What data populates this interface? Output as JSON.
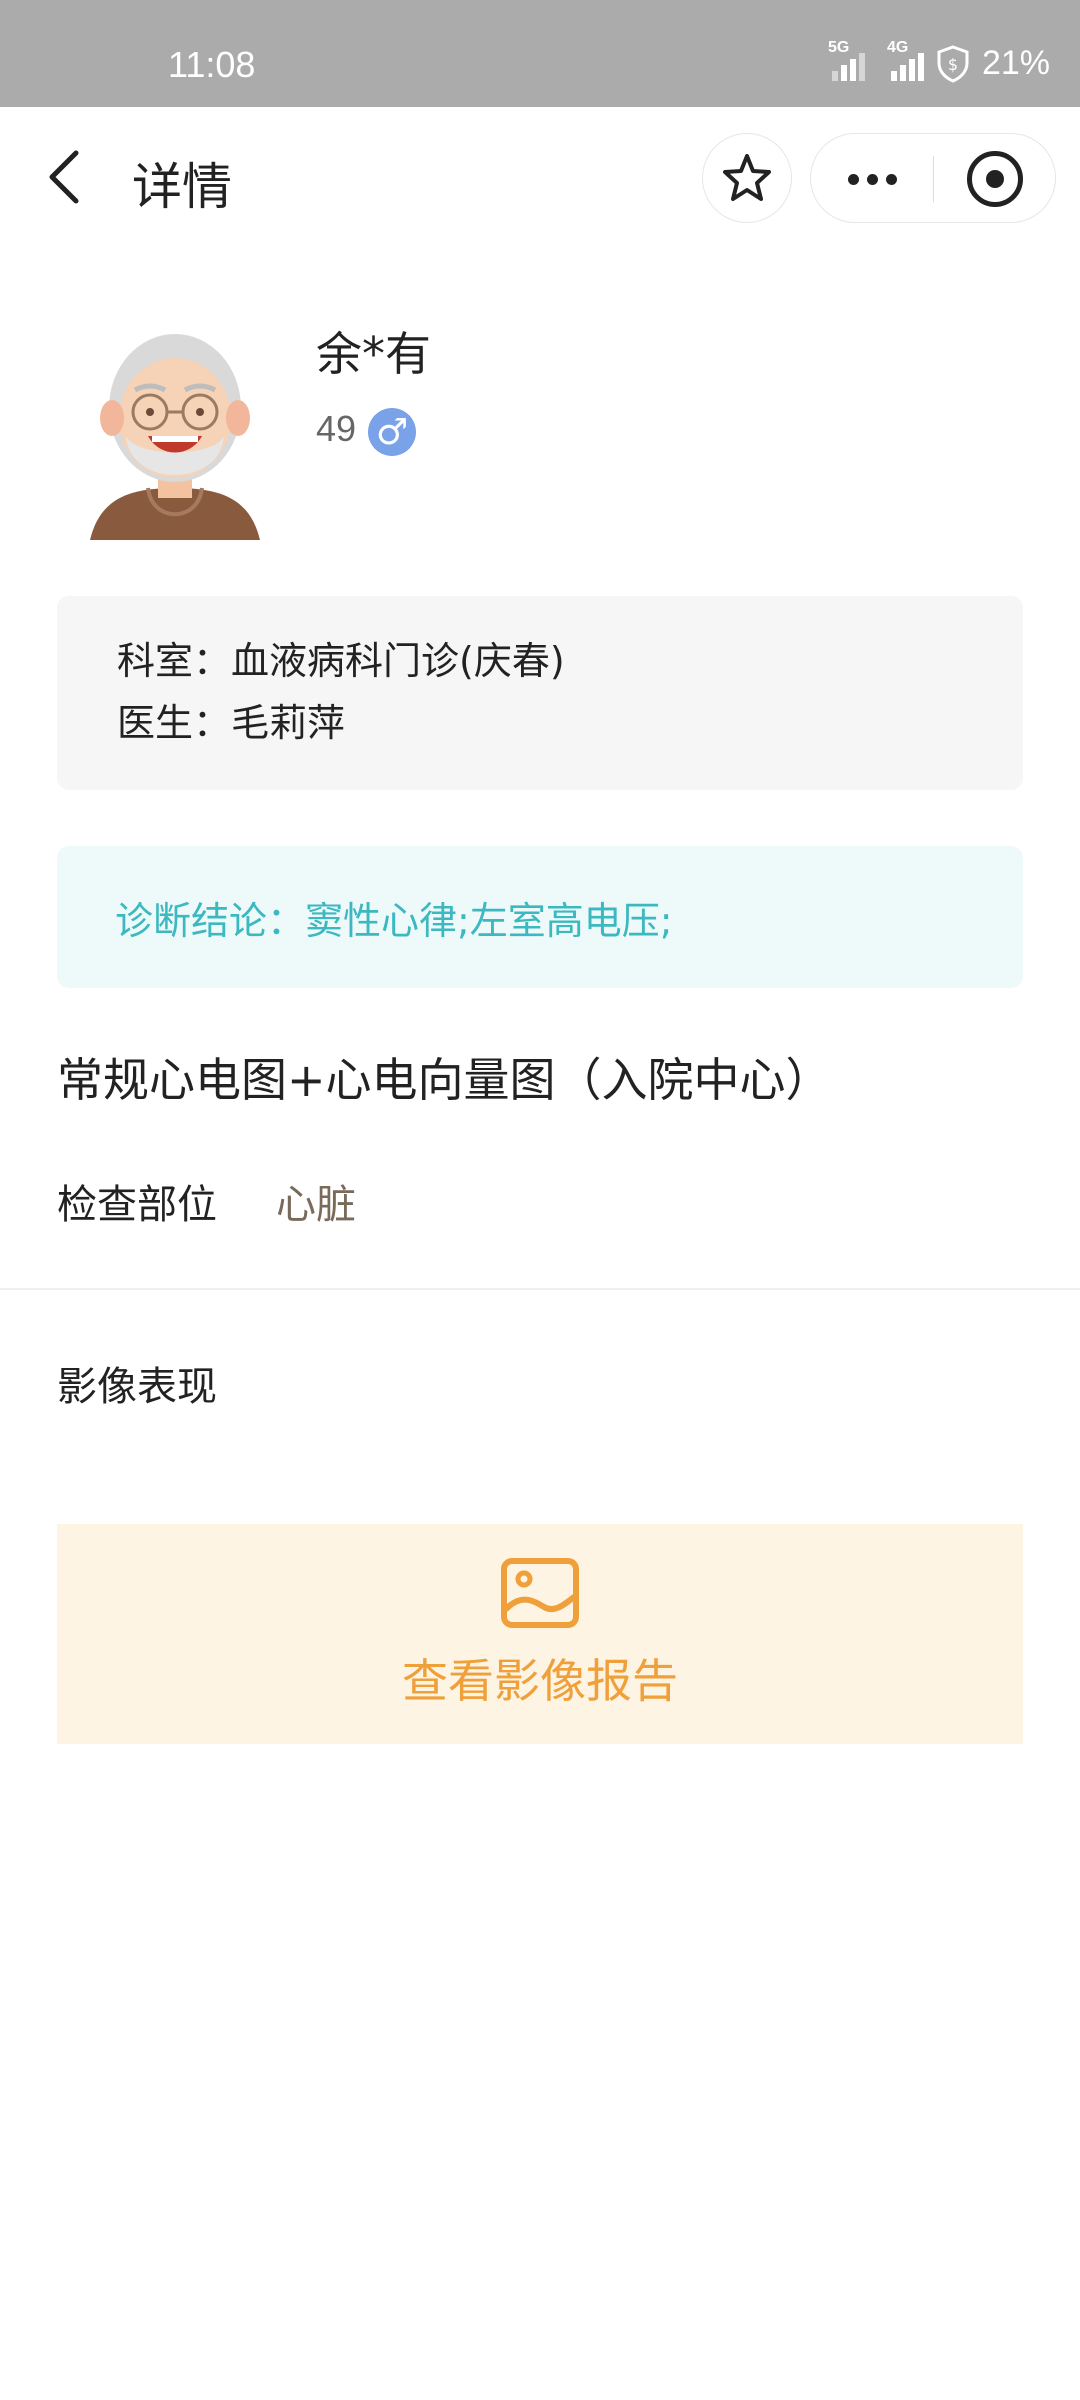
{
  "status_bar": {
    "time": "11:08",
    "signal1_tag": "5G",
    "signal2_tag": "4G",
    "battery": "21%"
  },
  "header": {
    "title": "详情"
  },
  "patient": {
    "name": "余*有",
    "age": "49",
    "gender_symbol": "♂"
  },
  "info": {
    "department": "科室：血液病科门诊(庆春)",
    "doctor": "医生：毛莉萍"
  },
  "diagnosis": "诊断结论：窦性心律;左室高电压;",
  "exam": {
    "title": "常规心电图+心电向量图（入院中心）",
    "part_label": "检查部位",
    "part_value": "心脏",
    "findings_label": "影像表现"
  },
  "report_button": {
    "label": "查看影像报告"
  },
  "colors": {
    "diagnosis_text": "#3bb8c0",
    "report_text": "#f0a03a",
    "gender_badge": "#7aa2e8"
  }
}
